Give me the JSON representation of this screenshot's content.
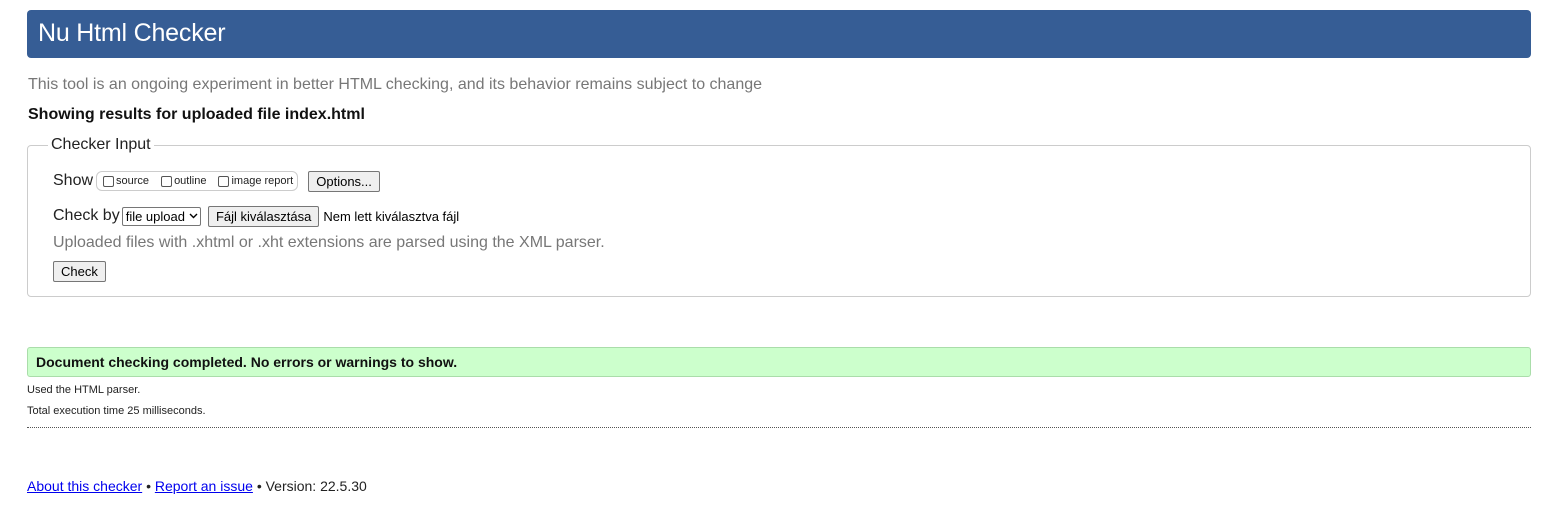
{
  "header": {
    "title": "Nu Html Checker"
  },
  "intro": "This tool is an ongoing experiment in better HTML checking, and its behavior remains subject to change",
  "results_heading": "Showing results for uploaded file index.html",
  "checker_input": {
    "legend": "Checker Input",
    "show_label": "Show",
    "show_options": [
      {
        "label": "source",
        "checked": false
      },
      {
        "label": "outline",
        "checked": false
      },
      {
        "label": "image report",
        "checked": false
      }
    ],
    "options_button": "Options...",
    "check_by_label": "Check by",
    "check_by_selected": "file upload",
    "file_button": "Fájl kiválasztása",
    "file_status": "Nem lett kiválasztva fájl",
    "note": "Uploaded files with .xhtml or .xht extensions are parsed using the XML parser.",
    "check_button": "Check"
  },
  "result": {
    "message": "Document checking completed. No errors or warnings to show.",
    "parser_line": "Used the HTML parser.",
    "time_line": "Total execution time 25 milliseconds."
  },
  "footer": {
    "about_link": "About this checker",
    "separator": "•",
    "report_link": "Report an issue",
    "version_text": "Version: 22.5.30"
  },
  "colors": {
    "header_bg": "#365d95",
    "success_bg": "#ccffcc",
    "link": "#0000ee",
    "muted_text": "#777777"
  }
}
